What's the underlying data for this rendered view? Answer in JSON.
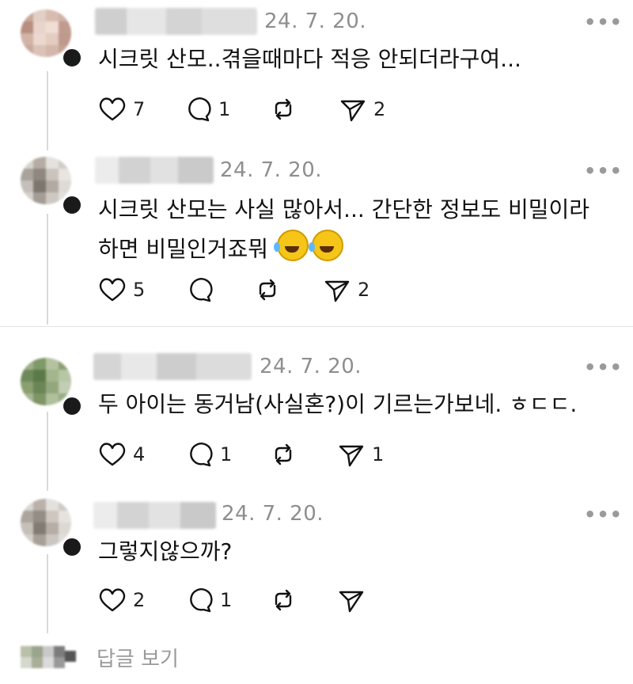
{
  "comments": [
    {
      "timestamp": "24. 7. 20.",
      "text": "시크릿 산모..겪을때마다 적응 안되더라구여...",
      "likes": "7",
      "replies": "1",
      "reposts": "",
      "shares": "2"
    },
    {
      "timestamp": "24. 7. 20.",
      "text": "시크릿 산모는 사실 많아서... 간단한 정보도 비밀이라 하면 비밀인거죠뭐",
      "emoji": "rolling-on-the-floor-laughing",
      "likes": "5",
      "replies": "",
      "reposts": "",
      "shares": "2"
    },
    {
      "timestamp": "24. 7. 20.",
      "text": "두 아이는 동거남(사실혼?)이 기르는가보네. ㅎㄷㄷ.",
      "likes": "4",
      "replies": "1",
      "reposts": "",
      "shares": "1"
    },
    {
      "timestamp": "24. 7. 20.",
      "text": "그렇지않으까?",
      "likes": "2",
      "replies": "1",
      "reposts": "",
      "shares": ""
    }
  ],
  "more_menu": "•••",
  "view_replies": "답글 보기",
  "icons": {
    "like": "heart-icon",
    "reply": "comment-icon",
    "repost": "repost-icon",
    "share": "send-icon",
    "more": "more-icon"
  }
}
